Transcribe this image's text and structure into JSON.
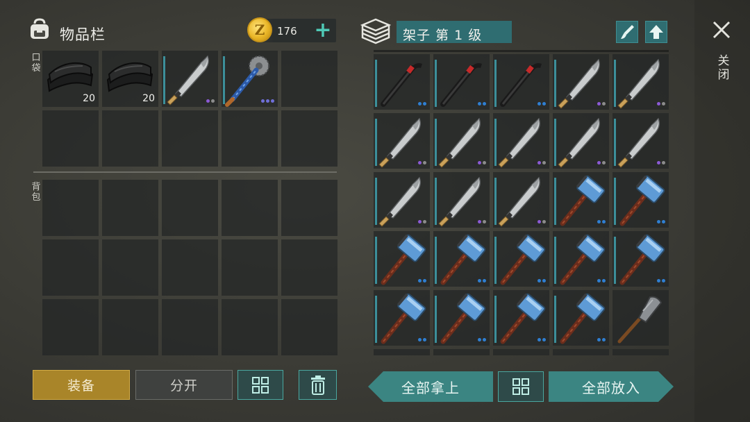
{
  "inventory": {
    "title": "物品栏",
    "coins": "176",
    "pocket_label": "口袋",
    "backpack_label": "背包",
    "pocket_slots": [
      {
        "item": "cloth-icon",
        "qty": "20",
        "dots": []
      },
      {
        "item": "cloth-icon",
        "qty": "20",
        "dots": []
      },
      {
        "item": "machete-icon",
        "qty": "",
        "dots": [
          "#2a2a2a",
          "#8c5ad6",
          "#8c8c8c"
        ]
      },
      {
        "item": "saw-mace-icon",
        "qty": "",
        "dots": [
          "#6f6fd8",
          "#6f6fd8",
          "#6f6fd8"
        ]
      },
      {
        "item": "",
        "qty": "",
        "dots": []
      },
      {
        "item": "",
        "qty": "",
        "dots": []
      },
      {
        "item": "",
        "qty": "",
        "dots": []
      },
      {
        "item": "",
        "qty": "",
        "dots": []
      },
      {
        "item": "",
        "qty": "",
        "dots": []
      },
      {
        "item": "",
        "qty": "",
        "dots": []
      }
    ],
    "backpack_slots": 15
  },
  "shelf": {
    "title": "架子 第 1 级",
    "close_label": "关闭",
    "items": [
      {
        "item": "crowbar-icon",
        "dots": [
          "#2f7fd2",
          "#2f7fd2"
        ]
      },
      {
        "item": "crowbar-icon",
        "dots": [
          "#2f7fd2",
          "#2f7fd2"
        ]
      },
      {
        "item": "crowbar-icon",
        "dots": [
          "#2f7fd2",
          "#2f7fd2"
        ]
      },
      {
        "item": "machete-icon",
        "dots": [
          "#2a2a2a",
          "#8c5ad6",
          "#8c8c8c"
        ]
      },
      {
        "item": "machete-icon",
        "dots": [
          "#2a2a2a",
          "#8c5ad6",
          "#8c8c8c"
        ]
      },
      {
        "item": "machete-icon",
        "dots": [
          "#2a2a2a",
          "#8c5ad6",
          "#8c8c8c"
        ]
      },
      {
        "item": "machete-icon",
        "dots": [
          "#2a2a2a",
          "#8c5ad6",
          "#8c8c8c"
        ]
      },
      {
        "item": "machete-icon",
        "dots": [
          "#2a2a2a",
          "#8c5ad6",
          "#8c8c8c"
        ]
      },
      {
        "item": "machete-icon",
        "dots": [
          "#2a2a2a",
          "#8c5ad6",
          "#8c8c8c"
        ]
      },
      {
        "item": "machete-icon",
        "dots": [
          "#2a2a2a",
          "#8c5ad6",
          "#8c8c8c"
        ]
      },
      {
        "item": "machete-icon",
        "dots": [
          "#2a2a2a",
          "#8c5ad6",
          "#8c8c8c"
        ]
      },
      {
        "item": "machete-icon",
        "dots": [
          "#2a2a2a",
          "#8c5ad6",
          "#8c8c8c"
        ]
      },
      {
        "item": "machete-icon",
        "dots": [
          "#2a2a2a",
          "#8c5ad6",
          "#8c8c8c"
        ]
      },
      {
        "item": "sledgehammer-icon",
        "dots": [
          "#2f7fd2",
          "#2f7fd2"
        ]
      },
      {
        "item": "sledgehammer-icon",
        "dots": [
          "#2f7fd2",
          "#2f7fd2"
        ]
      },
      {
        "item": "sledgehammer-icon",
        "dots": [
          "#2f7fd2",
          "#2f7fd2"
        ]
      },
      {
        "item": "sledgehammer-icon",
        "dots": [
          "#2f7fd2",
          "#2f7fd2"
        ]
      },
      {
        "item": "sledgehammer-icon",
        "dots": [
          "#2f7fd2",
          "#2f7fd2"
        ]
      },
      {
        "item": "sledgehammer-icon",
        "dots": [
          "#2f7fd2",
          "#2f7fd2"
        ]
      },
      {
        "item": "sledgehammer-icon",
        "dots": [
          "#2f7fd2",
          "#2f7fd2"
        ]
      },
      {
        "item": "sledgehammer-icon",
        "dots": [
          "#2f7fd2",
          "#2f7fd2"
        ]
      },
      {
        "item": "sledgehammer-icon",
        "dots": [
          "#2f7fd2",
          "#2f7fd2"
        ]
      },
      {
        "item": "sledgehammer-icon",
        "dots": [
          "#2f7fd2",
          "#2f7fd2"
        ]
      },
      {
        "item": "sledgehammer-icon",
        "dots": [
          "#2f7fd2",
          "#2f7fd2"
        ]
      },
      {
        "item": "shovel-icon",
        "dots": []
      },
      {
        "item": "",
        "dots": []
      },
      {
        "item": "",
        "dots": []
      },
      {
        "item": "",
        "dots": []
      },
      {
        "item": "",
        "dots": []
      },
      {
        "item": "",
        "dots": []
      }
    ]
  },
  "buttons": {
    "equip": "装备",
    "split": "分开",
    "take_all": "全部拿上",
    "put_all": "全部放入"
  },
  "colors": {
    "accent_teal": "#3b8582",
    "equip_gold": "#a98529",
    "coin_gold": "#e9b526"
  }
}
